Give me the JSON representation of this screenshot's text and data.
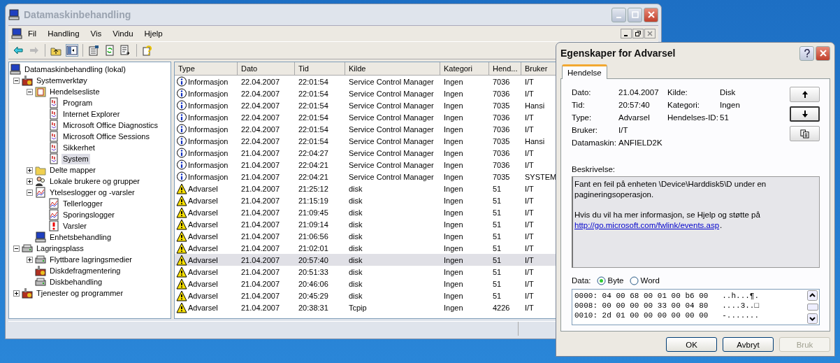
{
  "window": {
    "title": "Datamaskinbehandling"
  },
  "menu": [
    "Fil",
    "Handling",
    "Vis",
    "Vindu",
    "Hjelp"
  ],
  "tree": [
    {
      "label": "Datamaskinbehandling (lokal)",
      "kind": "computer",
      "selected": false,
      "children": [
        {
          "label": "Systemverktøy",
          "kind": "tools",
          "expanded": true,
          "selected": false,
          "children": [
            {
              "label": "Hendelsesliste",
              "kind": "viewer",
              "expanded": true,
              "selected": false,
              "children": [
                {
                  "label": "Program",
                  "kind": "log",
                  "selected": false
                },
                {
                  "label": "Internet Explorer",
                  "kind": "log",
                  "selected": false
                },
                {
                  "label": "Microsoft Office Diagnostics",
                  "kind": "log",
                  "selected": false
                },
                {
                  "label": "Microsoft Office Sessions",
                  "kind": "log",
                  "selected": false
                },
                {
                  "label": "Sikkerhet",
                  "kind": "log",
                  "selected": false
                },
                {
                  "label": "System",
                  "kind": "log",
                  "selected": true
                }
              ]
            },
            {
              "label": "Delte mapper",
              "kind": "folder",
              "expanded": false,
              "selected": false
            },
            {
              "label": "Lokale brukere og grupper",
              "kind": "users",
              "expanded": false,
              "selected": false
            },
            {
              "label": "Ytelseslogger og -varsler",
              "kind": "chart",
              "expanded": true,
              "selected": false,
              "children": [
                {
                  "label": "Tellerlogger",
                  "kind": "chart",
                  "selected": false
                },
                {
                  "label": "Sporingslogger",
                  "kind": "chart",
                  "selected": false
                },
                {
                  "label": "Varsler",
                  "kind": "alert",
                  "selected": false
                }
              ]
            },
            {
              "label": "Enhetsbehandling",
              "kind": "computer",
              "selected": false
            }
          ]
        },
        {
          "label": "Lagringsplass",
          "kind": "disk",
          "expanded": true,
          "selected": false,
          "children": [
            {
              "label": "Flyttbare lagringsmedier",
              "kind": "disk",
              "expanded": false,
              "selected": false
            },
            {
              "label": "Diskdefragmentering",
              "kind": "tools",
              "selected": false
            },
            {
              "label": "Diskbehandling",
              "kind": "disk",
              "selected": false
            }
          ]
        },
        {
          "label": "Tjenester og programmer",
          "kind": "tools",
          "expanded": false,
          "selected": false
        }
      ]
    }
  ],
  "list": {
    "columns": [
      "Type",
      "Dato",
      "Tid",
      "Kilde",
      "Kategori",
      "Hend...",
      "Bruker"
    ],
    "rows": [
      {
        "kind": "info",
        "cells": [
          "Informasjon",
          "22.04.2007",
          "22:01:54",
          "Service Control Manager",
          "Ingen",
          "7036",
          "I/T"
        ],
        "selected": false
      },
      {
        "kind": "info",
        "cells": [
          "Informasjon",
          "22.04.2007",
          "22:01:54",
          "Service Control Manager",
          "Ingen",
          "7036",
          "I/T"
        ],
        "selected": false
      },
      {
        "kind": "info",
        "cells": [
          "Informasjon",
          "22.04.2007",
          "22:01:54",
          "Service Control Manager",
          "Ingen",
          "7035",
          "Hansi"
        ],
        "selected": false
      },
      {
        "kind": "info",
        "cells": [
          "Informasjon",
          "22.04.2007",
          "22:01:54",
          "Service Control Manager",
          "Ingen",
          "7036",
          "I/T"
        ],
        "selected": false
      },
      {
        "kind": "info",
        "cells": [
          "Informasjon",
          "22.04.2007",
          "22:01:54",
          "Service Control Manager",
          "Ingen",
          "7036",
          "I/T"
        ],
        "selected": false
      },
      {
        "kind": "info",
        "cells": [
          "Informasjon",
          "22.04.2007",
          "22:01:54",
          "Service Control Manager",
          "Ingen",
          "7035",
          "Hansi"
        ],
        "selected": false
      },
      {
        "kind": "info",
        "cells": [
          "Informasjon",
          "21.04.2007",
          "22:04:27",
          "Service Control Manager",
          "Ingen",
          "7036",
          "I/T"
        ],
        "selected": false
      },
      {
        "kind": "info",
        "cells": [
          "Informasjon",
          "21.04.2007",
          "22:04:21",
          "Service Control Manager",
          "Ingen",
          "7036",
          "I/T"
        ],
        "selected": false
      },
      {
        "kind": "info",
        "cells": [
          "Informasjon",
          "21.04.2007",
          "22:04:21",
          "Service Control Manager",
          "Ingen",
          "7035",
          "SYSTEM"
        ],
        "selected": false
      },
      {
        "kind": "warning",
        "cells": [
          "Advarsel",
          "21.04.2007",
          "21:25:12",
          "disk",
          "Ingen",
          "51",
          "I/T"
        ],
        "selected": false
      },
      {
        "kind": "warning",
        "cells": [
          "Advarsel",
          "21.04.2007",
          "21:15:19",
          "disk",
          "Ingen",
          "51",
          "I/T"
        ],
        "selected": false
      },
      {
        "kind": "warning",
        "cells": [
          "Advarsel",
          "21.04.2007",
          "21:09:45",
          "disk",
          "Ingen",
          "51",
          "I/T"
        ],
        "selected": false
      },
      {
        "kind": "warning",
        "cells": [
          "Advarsel",
          "21.04.2007",
          "21:09:14",
          "disk",
          "Ingen",
          "51",
          "I/T"
        ],
        "selected": false
      },
      {
        "kind": "warning",
        "cells": [
          "Advarsel",
          "21.04.2007",
          "21:06:56",
          "disk",
          "Ingen",
          "51",
          "I/T"
        ],
        "selected": false
      },
      {
        "kind": "warning",
        "cells": [
          "Advarsel",
          "21.04.2007",
          "21:02:01",
          "disk",
          "Ingen",
          "51",
          "I/T"
        ],
        "selected": false
      },
      {
        "kind": "warning",
        "cells": [
          "Advarsel",
          "21.04.2007",
          "20:57:40",
          "disk",
          "Ingen",
          "51",
          "I/T"
        ],
        "selected": true
      },
      {
        "kind": "warning",
        "cells": [
          "Advarsel",
          "21.04.2007",
          "20:51:33",
          "disk",
          "Ingen",
          "51",
          "I/T"
        ],
        "selected": false
      },
      {
        "kind": "warning",
        "cells": [
          "Advarsel",
          "21.04.2007",
          "20:46:06",
          "disk",
          "Ingen",
          "51",
          "I/T"
        ],
        "selected": false
      },
      {
        "kind": "warning",
        "cells": [
          "Advarsel",
          "21.04.2007",
          "20:45:29",
          "disk",
          "Ingen",
          "51",
          "I/T"
        ],
        "selected": false
      },
      {
        "kind": "warning",
        "cells": [
          "Advarsel",
          "21.04.2007",
          "20:38:31",
          "Tcpip",
          "Ingen",
          "4226",
          "I/T"
        ],
        "selected": false
      }
    ]
  },
  "dialog": {
    "title": "Egenskaper for Advarsel",
    "tabs": [
      {
        "label": "Hendelse",
        "selected": true
      }
    ],
    "fields_left": [
      {
        "label": "Dato:",
        "value": "21.04.2007"
      },
      {
        "label": "Tid:",
        "value": "20:57:40"
      },
      {
        "label": "Type:",
        "value": "Advarsel"
      },
      {
        "label": "Bruker:",
        "value": "I/T"
      },
      {
        "label": "Datamaskin:",
        "value": "ANFIELD2K"
      }
    ],
    "fields_right": [
      {
        "label": "Kilde:",
        "value": "Disk"
      },
      {
        "label": "Kategori:",
        "value": "Ingen"
      },
      {
        "label": "Hendelses-ID:",
        "value": "51"
      }
    ],
    "description_label": "Beskrivelse:",
    "description": {
      "paragraph": "Fant en feil på enheten \\Device\\Harddisk5\\D under en pagineringsoperasjon.",
      "help_text": "Hvis du vil ha mer informasjon, se Hjelp og støtte på",
      "link": "http://go.microsoft.com/fwlink/events.asp",
      "link_suffix": "."
    },
    "data_label": "Data:",
    "data_options": [
      {
        "label": "Byte",
        "selected": true
      },
      {
        "label": "Word",
        "selected": false
      }
    ],
    "hex_rows": [
      "0000: 04 00 68 00 01 00 b6 00   ..h...¶.",
      "0008: 00 00 00 00 33 00 04 80   ....3..□",
      "0010: 2d 01 00 00 00 00 00 00   -......."
    ],
    "buttons": [
      {
        "label": "OK",
        "disabled": false
      },
      {
        "label": "Avbryt",
        "disabled": false
      },
      {
        "label": "Bruk",
        "disabled": true
      }
    ]
  }
}
